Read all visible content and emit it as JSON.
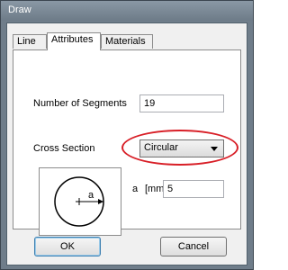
{
  "window": {
    "title": "Draw"
  },
  "tabs": [
    {
      "label": "Line",
      "active": false
    },
    {
      "label": "Attributes",
      "active": true
    },
    {
      "label": "Materials",
      "active": false
    }
  ],
  "form": {
    "segments_label": "Number of Segments",
    "segments_value": "19",
    "cross_section_label": "Cross Section",
    "cross_section_value": "Circular",
    "a_label": "a",
    "a_unit": "[mm]",
    "a_value": "5"
  },
  "diagram": {
    "dimension_label": "a"
  },
  "buttons": {
    "ok": "OK",
    "cancel": "Cancel"
  },
  "colors": {
    "highlight": "#d81f27"
  }
}
